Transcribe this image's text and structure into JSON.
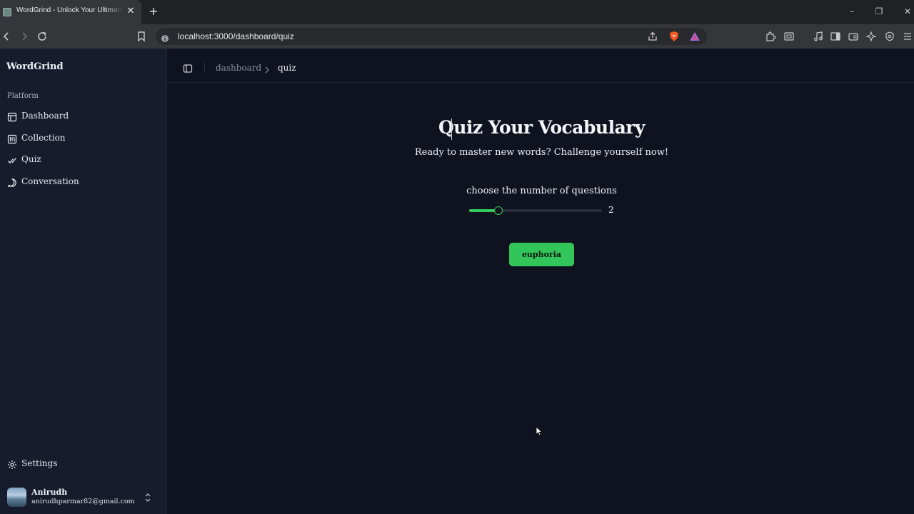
{
  "browser": {
    "tab_title": "WordGrind - Unlock Your Ultimate",
    "tab_close": "✕",
    "new_tab": "+",
    "window_controls": [
      "–",
      "❐",
      "✕"
    ],
    "url": "localhost:3000/dashboard/quiz",
    "accent_colors": {
      "brave": "#f05a28",
      "rewards": "#a06bd6"
    }
  },
  "sidebar": {
    "brand": "WordGrind",
    "group_label": "Platform",
    "items": [
      {
        "label": "Dashboard",
        "icon": "layout-icon"
      },
      {
        "label": "Collection",
        "icon": "library-icon"
      },
      {
        "label": "Quiz",
        "icon": "check-icon"
      },
      {
        "label": "Conversation",
        "icon": "message-icon"
      }
    ],
    "footer_item": {
      "label": "Settings",
      "icon": "gear-icon"
    },
    "user": {
      "name": "Anirudh",
      "email": "anirudhparmar82@gmail.com"
    }
  },
  "header": {
    "breadcrumb": [
      "dashboard",
      "quiz"
    ]
  },
  "quiz": {
    "title": "Quiz Your Vocabulary",
    "subtitle": "Ready to master new words? Challenge yourself now!",
    "question_label": "choose the number of questions",
    "slider_value": "2",
    "slider_fraction": 0.22,
    "start_button": "euphoria",
    "accent_color": "#34c759"
  }
}
